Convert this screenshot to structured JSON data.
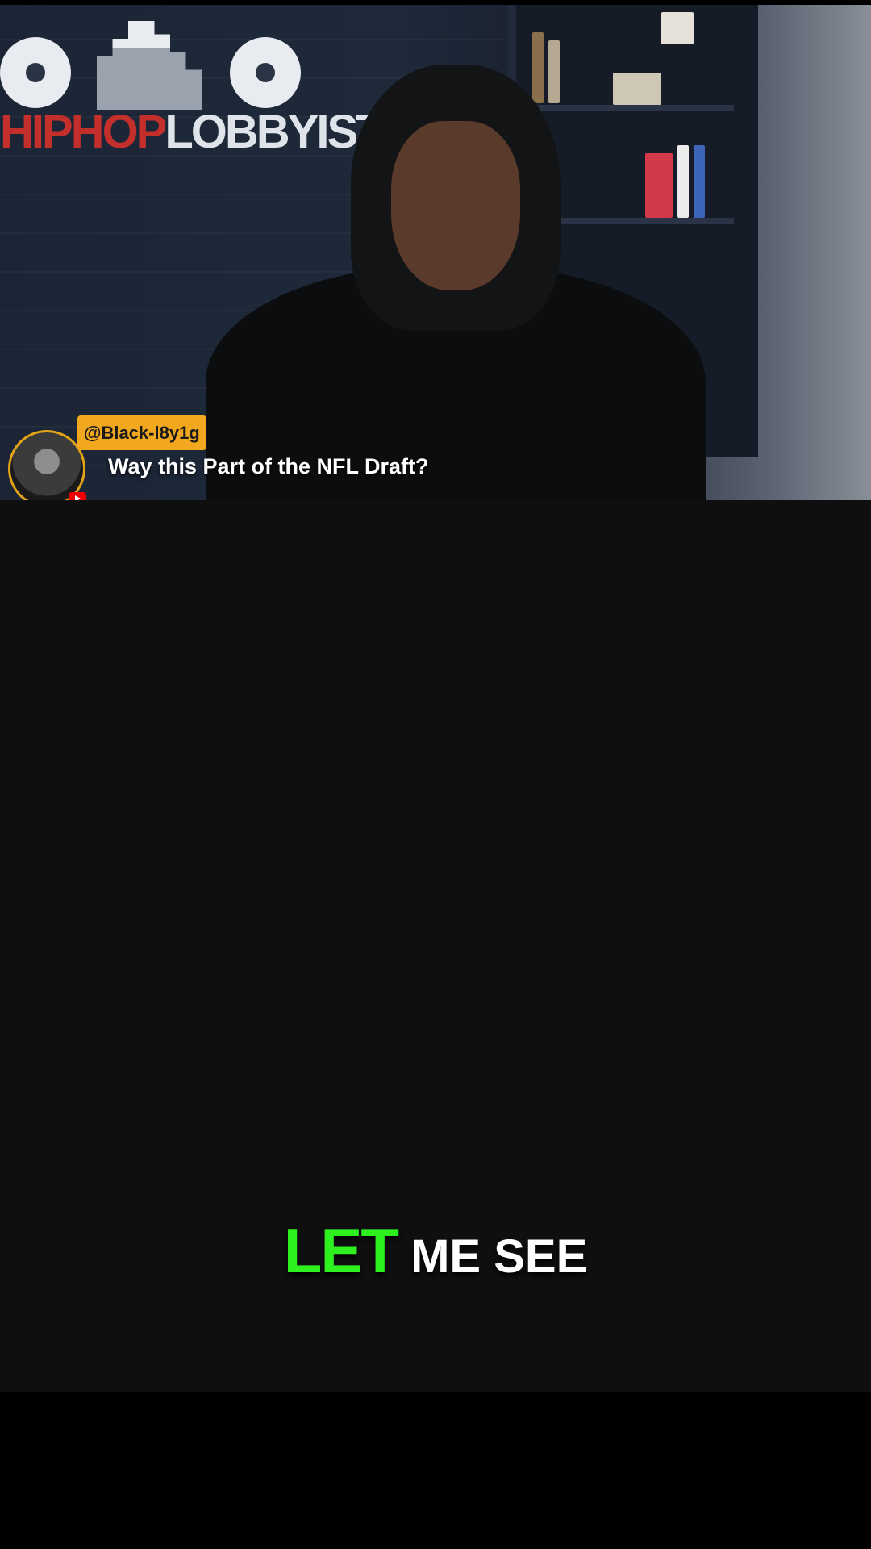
{
  "video": {
    "logo_part1": "HIPHOP",
    "logo_part2": "LOBBYIST"
  },
  "comment": {
    "username": "@Black-l8y1g",
    "text": "Way this Part of the NFL Draft?",
    "platform_icon": "youtube-icon",
    "badge_color": "#f2a81e"
  },
  "caption": {
    "highlight_word": "LET",
    "rest_words": "ME SEE",
    "highlight_color": "#2ff01f"
  }
}
